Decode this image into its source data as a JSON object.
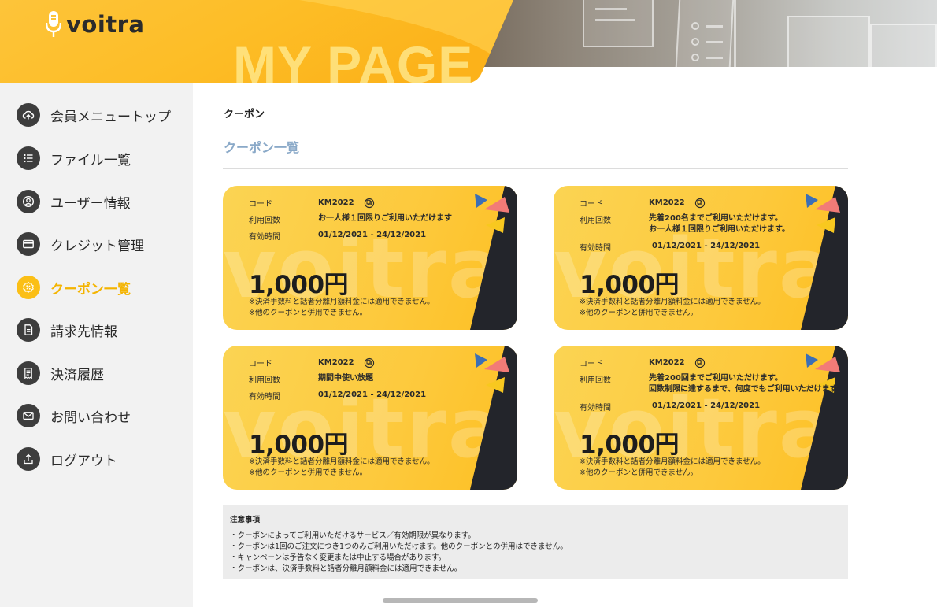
{
  "brand": {
    "logo_text": "voitra",
    "header_title": "MY PAGE",
    "accent_color": "#fbbf16"
  },
  "sidebar": {
    "items": [
      {
        "label": "会員メニュートップ",
        "icon": "cloud-upload-icon",
        "active": false
      },
      {
        "label": "ファイル一覧",
        "icon": "list-icon",
        "active": false
      },
      {
        "label": "ユーザー情報",
        "icon": "user-circle-icon",
        "active": false
      },
      {
        "label": "クレジット管理",
        "icon": "credit-card-icon",
        "active": false
      },
      {
        "label": "クーポン一覧",
        "icon": "coupon-badge-icon",
        "active": true
      },
      {
        "label": "請求先情報",
        "icon": "document-icon",
        "active": false
      },
      {
        "label": "決済履歴",
        "icon": "receipt-icon",
        "active": false
      },
      {
        "label": "お問い合わせ",
        "icon": "mail-icon",
        "active": false
      },
      {
        "label": "ログアウト",
        "icon": "logout-icon",
        "active": false
      }
    ]
  },
  "main": {
    "breadcrumb": "クーポン",
    "title": "クーポン一覧",
    "labels": {
      "code": "コード",
      "usage": "利用回数",
      "validity": "有効時間"
    },
    "coupons": [
      {
        "code": "KM2022",
        "usage_lines": [
          "お一人様１回限りご利用いただけます"
        ],
        "validity": "01/12/2021 - 24/12/2021",
        "amount": "1,000円",
        "notes": [
          "※決済手数料と話者分離月額料金には適用できません。",
          "※他のクーポンと併用できません。"
        ],
        "watermark": "voitra"
      },
      {
        "code": "KM2022",
        "usage_lines": [
          "先着200名までご利用いただけます。",
          "お一人様１回限りご利用いただけます。"
        ],
        "validity": "01/12/2021 - 24/12/2021",
        "amount": "1,000円",
        "notes": [
          "※決済手数料と話者分離月額料金には適用できません。",
          "※他のクーポンと併用できません。"
        ],
        "watermark": "voitra"
      },
      {
        "code": "KM2022",
        "usage_lines": [
          "期間中使い放題"
        ],
        "validity": "01/12/2021 - 24/12/2021",
        "amount": "1,000円",
        "notes": [
          "※決済手数料と話者分離月額料金には適用できません。",
          "※他のクーポンと併用できません。"
        ],
        "watermark": "voitra"
      },
      {
        "code": "KM2022",
        "usage_lines": [
          "先着200回までご利用いただけます。",
          "回数制限に達するまで、何度でもご利用いただけます"
        ],
        "validity": "01/12/2021 - 24/12/2021",
        "amount": "1,000円",
        "notes": [
          "※決済手数料と話者分離月額料金には適用できません。",
          "※他のクーポンと併用できません。"
        ],
        "watermark": "voitra"
      }
    ],
    "notice": {
      "title": "注意事項",
      "items": [
        "・クーポンによってご利用いただけるサービス／有効期限が異なります。",
        "・クーポンは1回のご注文につき1つのみご利用いただけます。他のクーポンとの併用はできません。",
        "・キャンペーンは予告なく変更または中止する場合があります。",
        "・クーポンは、決済手数料と話者分離月額料金には適用できません。"
      ]
    }
  }
}
